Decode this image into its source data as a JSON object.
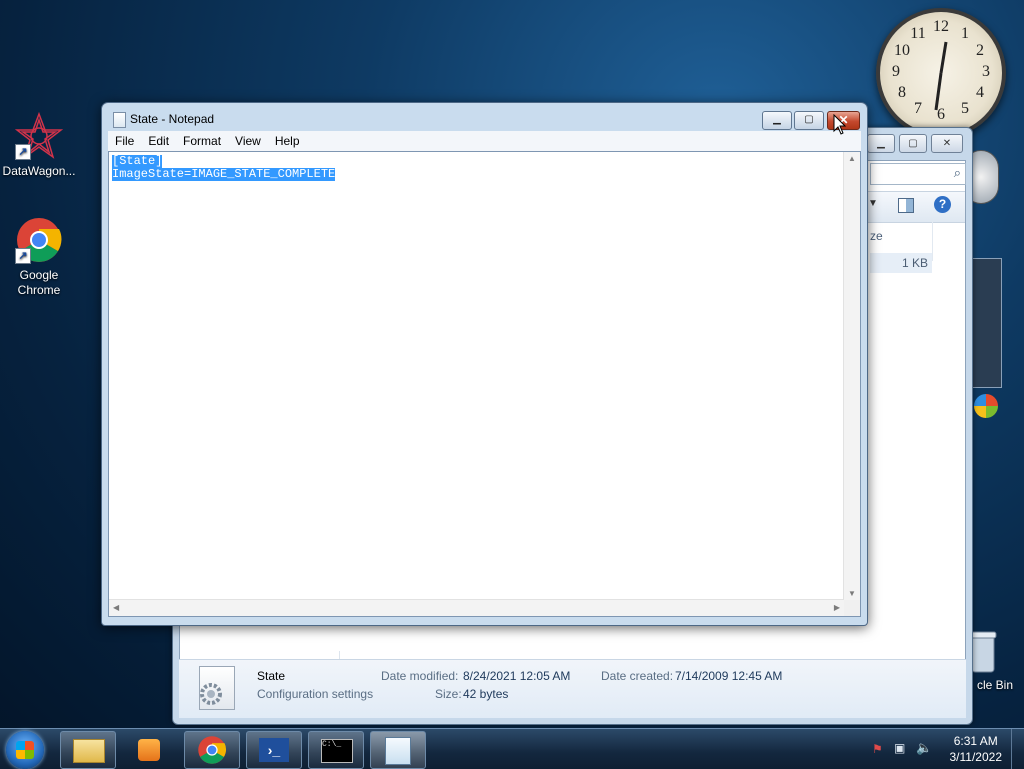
{
  "desktop": {
    "icons": [
      {
        "label": "DataWagon..."
      },
      {
        "label": "Google Chrome"
      },
      {
        "label": "cle Bin"
      }
    ]
  },
  "clock_gadget": {
    "numbers": [
      "12",
      "1",
      "2",
      "3",
      "4",
      "5",
      "6",
      "7",
      "8",
      "9",
      "10",
      "11"
    ]
  },
  "explorer": {
    "size_header": "ze",
    "size_value": "1 KB",
    "details": {
      "name": "State",
      "type": "Configuration settings",
      "modified_label": "Date modified:",
      "modified_value": "8/24/2021 12:05 AM",
      "created_label": "Date created:",
      "created_value": "7/14/2009 12:45 AM",
      "size_label": "Size:",
      "size_value": "42 bytes"
    }
  },
  "notepad": {
    "title": "State - Notepad",
    "menu": [
      "File",
      "Edit",
      "Format",
      "View",
      "Help"
    ],
    "lines": [
      "[State]",
      "ImageState=IMAGE_STATE_COMPLETE"
    ]
  },
  "taskbar": {
    "time": "6:31 AM",
    "date": "3/11/2022"
  },
  "colors": {
    "selection": "#3399ff",
    "close_button": "#c4492e"
  }
}
